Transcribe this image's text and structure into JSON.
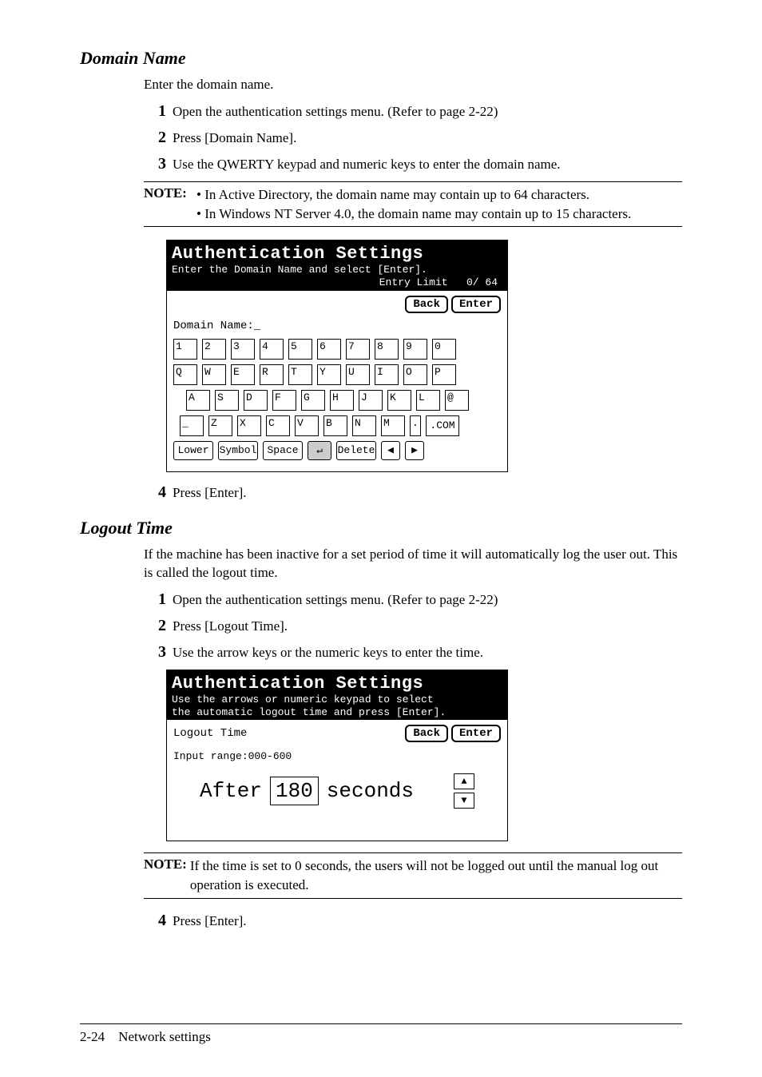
{
  "section1": {
    "title": "Domain Name",
    "intro": "Enter the domain name.",
    "steps": [
      "Open the authentication settings menu. (Refer to page 2-22)",
      "Press [Domain Name].",
      "Use the QWERTY keypad and numeric keys to enter the domain name."
    ],
    "step4": "Press [Enter].",
    "note_label": "NOTE:",
    "note_bullets": [
      "In Active Directory, the domain name may contain up to 64 characters.",
      "In Windows NT Server 4.0, the domain name may contain up to 15 characters."
    ]
  },
  "lcd1": {
    "title": "Authentication Settings",
    "subtitle": "Enter the Domain Name and select [Enter].",
    "entry_label": "Entry Limit",
    "entry_value": "0/ 64",
    "back": "Back",
    "enter": "Enter",
    "field_label": "Domain Name:_",
    "row1": [
      "1",
      "2",
      "3",
      "4",
      "5",
      "6",
      "7",
      "8",
      "9",
      "0"
    ],
    "row2": [
      "Q",
      "W",
      "E",
      "R",
      "T",
      "Y",
      "U",
      "I",
      "O",
      "P"
    ],
    "row3": [
      "A",
      "S",
      "D",
      "F",
      "G",
      "H",
      "J",
      "K",
      "L",
      "@"
    ],
    "row4": [
      "_",
      "Z",
      "X",
      "C",
      "V",
      "B",
      "N",
      "M",
      ".",
      ".COM"
    ],
    "bottom": {
      "lower": "Lower",
      "symbol": "Symbol",
      "space": "Space",
      "bksp": "↵",
      "delete": "Delete",
      "left": "◀",
      "right": "▶"
    }
  },
  "section2": {
    "title": "Logout Time",
    "intro": "If the machine has been inactive for a set period of time it will automatically log the user out. This is called the logout time.",
    "steps": [
      "Open the authentication settings menu. (Refer to page 2-22)",
      "Press [Logout Time].",
      "Use the arrow keys or the numeric keys to enter the time."
    ],
    "step4": "Press [Enter].",
    "note_label": "NOTE:",
    "note_text": "If the time is set to 0 seconds, the users will not be logged out until the manual log out operation is executed."
  },
  "lcd2": {
    "title": "Authentication Settings",
    "sub1": "Use the arrows or numeric keypad to select",
    "sub2": "the automatic logout time and press [Enter].",
    "label": "Logout Time",
    "back": "Back",
    "enter": "Enter",
    "range": "Input range:000-600",
    "after": "After",
    "value": "180",
    "seconds": "seconds",
    "up": "▲",
    "down": "▼"
  },
  "footer": {
    "page": "2-24",
    "title": "Network settings"
  }
}
